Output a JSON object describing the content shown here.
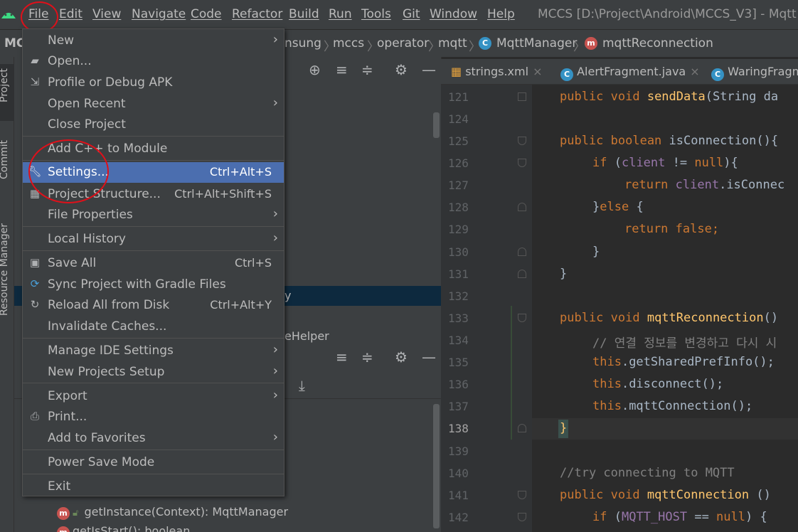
{
  "menubar": {
    "items": [
      "File",
      "Edit",
      "View",
      "Navigate",
      "Code",
      "Refactor",
      "Build",
      "Run",
      "Tools",
      "Git",
      "Window",
      "Help"
    ],
    "window_title": "MCCS [D:\\Project\\Android\\MCCS_V3] - Mqtt"
  },
  "breadcrumb": {
    "project": "MC",
    "items": [
      "nsung",
      "mccs",
      "operator",
      "mqtt",
      "MqttManager",
      "mqttReconnection"
    ]
  },
  "side_strip": {
    "project": "Project",
    "commit": "Commit",
    "resource_manager": "Resource Manager"
  },
  "project_panel": {
    "partial_row_1": "y",
    "partial_row_2": "eHelper",
    "method_row": "getInstance(Context): MqttManager",
    "method_row_cut": "getIsStart(): boolean"
  },
  "file_menu": {
    "items": [
      {
        "label": "New",
        "shortcut": "",
        "arrow": true,
        "icon": ""
      },
      {
        "label": "Open...",
        "shortcut": "",
        "arrow": false,
        "icon": "folder-icon"
      },
      {
        "label": "Profile or Debug APK",
        "shortcut": "",
        "arrow": false,
        "icon": "profile-icon"
      },
      {
        "label": "Open Recent",
        "shortcut": "",
        "arrow": true,
        "icon": ""
      },
      {
        "label": "Close Project",
        "shortcut": "",
        "arrow": false,
        "icon": ""
      },
      {
        "label": "Add C++ to Module",
        "shortcut": "",
        "arrow": false,
        "icon": ""
      },
      {
        "label": "Settings...",
        "shortcut": "Ctrl+Alt+S",
        "arrow": false,
        "icon": "wrench-icon"
      },
      {
        "label": "Project Structure...",
        "shortcut": "Ctrl+Alt+Shift+S",
        "arrow": false,
        "icon": "project-structure-icon"
      },
      {
        "label": "File Properties",
        "shortcut": "",
        "arrow": true,
        "icon": ""
      },
      {
        "label": "Local History",
        "shortcut": "",
        "arrow": true,
        "icon": ""
      },
      {
        "label": "Save All",
        "shortcut": "Ctrl+S",
        "arrow": false,
        "icon": "save-icon"
      },
      {
        "label": "Sync Project with Gradle Files",
        "shortcut": "",
        "arrow": false,
        "icon": "gradle-sync-icon"
      },
      {
        "label": "Reload All from Disk",
        "shortcut": "Ctrl+Alt+Y",
        "arrow": false,
        "icon": "reload-icon"
      },
      {
        "label": "Invalidate Caches...",
        "shortcut": "",
        "arrow": false,
        "icon": ""
      },
      {
        "label": "Manage IDE Settings",
        "shortcut": "",
        "arrow": true,
        "icon": ""
      },
      {
        "label": "New Projects Setup",
        "shortcut": "",
        "arrow": true,
        "icon": ""
      },
      {
        "label": "Export",
        "shortcut": "",
        "arrow": true,
        "icon": ""
      },
      {
        "label": "Print...",
        "shortcut": "",
        "arrow": false,
        "icon": "print-icon"
      },
      {
        "label": "Add to Favorites",
        "shortcut": "",
        "arrow": true,
        "icon": ""
      },
      {
        "label": "Power Save Mode",
        "shortcut": "",
        "arrow": false,
        "icon": ""
      },
      {
        "label": "Exit",
        "shortcut": "",
        "arrow": false,
        "icon": ""
      }
    ],
    "selected": "Settings..."
  },
  "editor": {
    "tabs": [
      "strings.xml",
      "AlertFragment.java",
      "WaringFragm"
    ],
    "line_numbers": [
      "121",
      "124",
      "125",
      "126",
      "127",
      "128",
      "129",
      "130",
      "131",
      "132",
      "133",
      "134",
      "135",
      "136",
      "137",
      "138",
      "139",
      "140",
      "141",
      "142"
    ],
    "current_line": "138",
    "code": {
      "l121_kw": "public void ",
      "l121_fn": "sendData",
      "l121_rest": "(String da",
      "l125_kw": "public boolean ",
      "l125_rest": "isConnection(){",
      "l126_kw": "if ",
      "l126_p1": "(",
      "l126_fld": "client",
      "l126_p2": " != ",
      "l126_kw2": "null",
      "l126_p3": "){",
      "l127_kw": "return ",
      "l127_fld": "client",
      "l127_rest": ".isConnec",
      "l128_p": "}",
      "l128_kw": "else ",
      "l128_p2": "{",
      "l129_kw": "return false;",
      "l130": "}",
      "l131": "}",
      "l133_kw": "public void ",
      "l133_fn": "mqttReconnection",
      "l133_rest": "()",
      "l134": "// 연결 정보를 변경하고 다시 시",
      "l135_kw": "this",
      "l135_rest": ".getSharedPrefInfo();",
      "l136_kw": "this",
      "l136_rest": ".disconnect();",
      "l137_kw": "this",
      "l137_rest": ".mqttConnection();",
      "l138": "}",
      "l140": "//try connecting to MQTT",
      "l141_kw": "public void ",
      "l141_fn": "mqttConnection",
      "l141_rest": " ()",
      "l142_kw": "if ",
      "l142_p1": "(",
      "l142_fld": "MQTT_HOST",
      "l142_p2": " == ",
      "l142_kw2": "null",
      "l142_p3": ") {"
    }
  },
  "colors": {
    "accent_select": "#4b6eaf",
    "annotation": "#e0101a",
    "keyword": "#cc7832",
    "function": "#ffc66d",
    "field": "#9876aa"
  }
}
